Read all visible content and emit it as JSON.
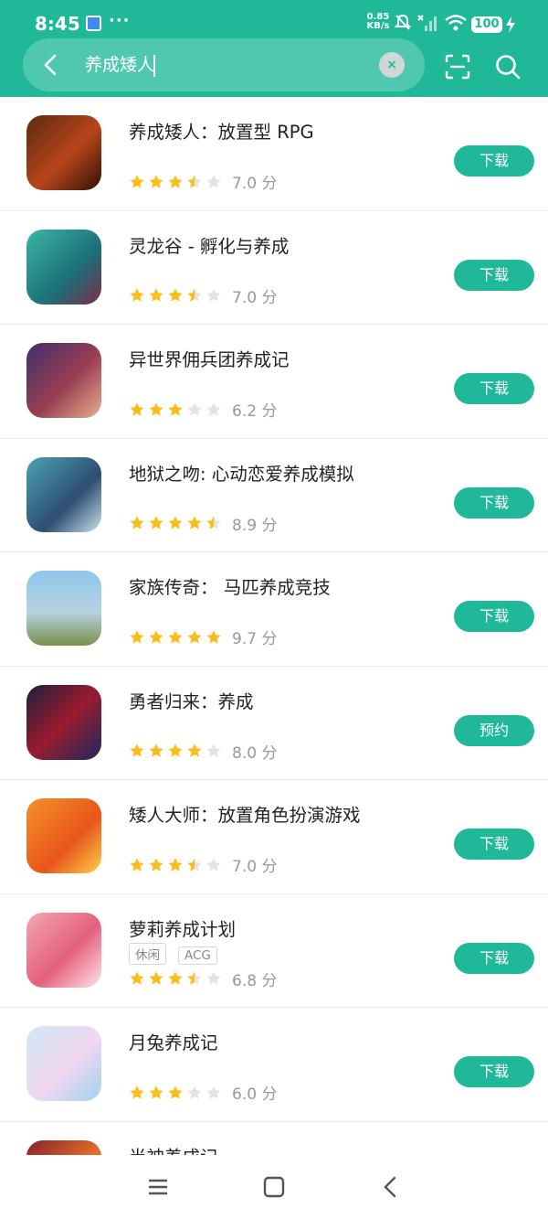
{
  "status": {
    "time": "8:45",
    "dots": "···",
    "net_speed": "0.85\nKB/s",
    "battery": "100"
  },
  "search": {
    "query": "养成矮人",
    "clear_label": "×"
  },
  "colors": {
    "accent": "#1fb99a",
    "star_filled": "#fbbd19",
    "star_empty": "#e3e3e3"
  },
  "apps": [
    {
      "name": "养成矮人：放置型 RPG",
      "score": "7.0 分",
      "stars": 3.5,
      "button": "下载",
      "tags": []
    },
    {
      "name": "灵龙谷 - 孵化与养成",
      "score": "7.0 分",
      "stars": 3.5,
      "button": "下载",
      "tags": []
    },
    {
      "name": "异世界佣兵团养成记",
      "score": "6.2 分",
      "stars": 3,
      "button": "下载",
      "tags": []
    },
    {
      "name": "地狱之吻: 心动恋爱养成模拟",
      "score": "8.9 分",
      "stars": 4.5,
      "button": "下载",
      "tags": []
    },
    {
      "name": "家族传奇： 马匹养成竞技",
      "score": "9.7 分",
      "stars": 5,
      "button": "下载",
      "tags": []
    },
    {
      "name": "勇者归来：养成",
      "score": "8.0 分",
      "stars": 4,
      "button": "预约",
      "tags": []
    },
    {
      "name": "矮人大师：放置角色扮演游戏",
      "score": "7.0 分",
      "stars": 3.5,
      "button": "下载",
      "tags": []
    },
    {
      "name": "萝莉养成计划",
      "score": "6.8 分",
      "stars": 3.5,
      "button": "下载",
      "tags": [
        "休闲",
        "ACG"
      ]
    },
    {
      "name": "月兔养成记",
      "score": "6.0 分",
      "stars": 3,
      "button": "下载",
      "tags": []
    },
    {
      "name": "半神养成记",
      "score": "",
      "stars": 0,
      "button": "",
      "tags": []
    }
  ]
}
